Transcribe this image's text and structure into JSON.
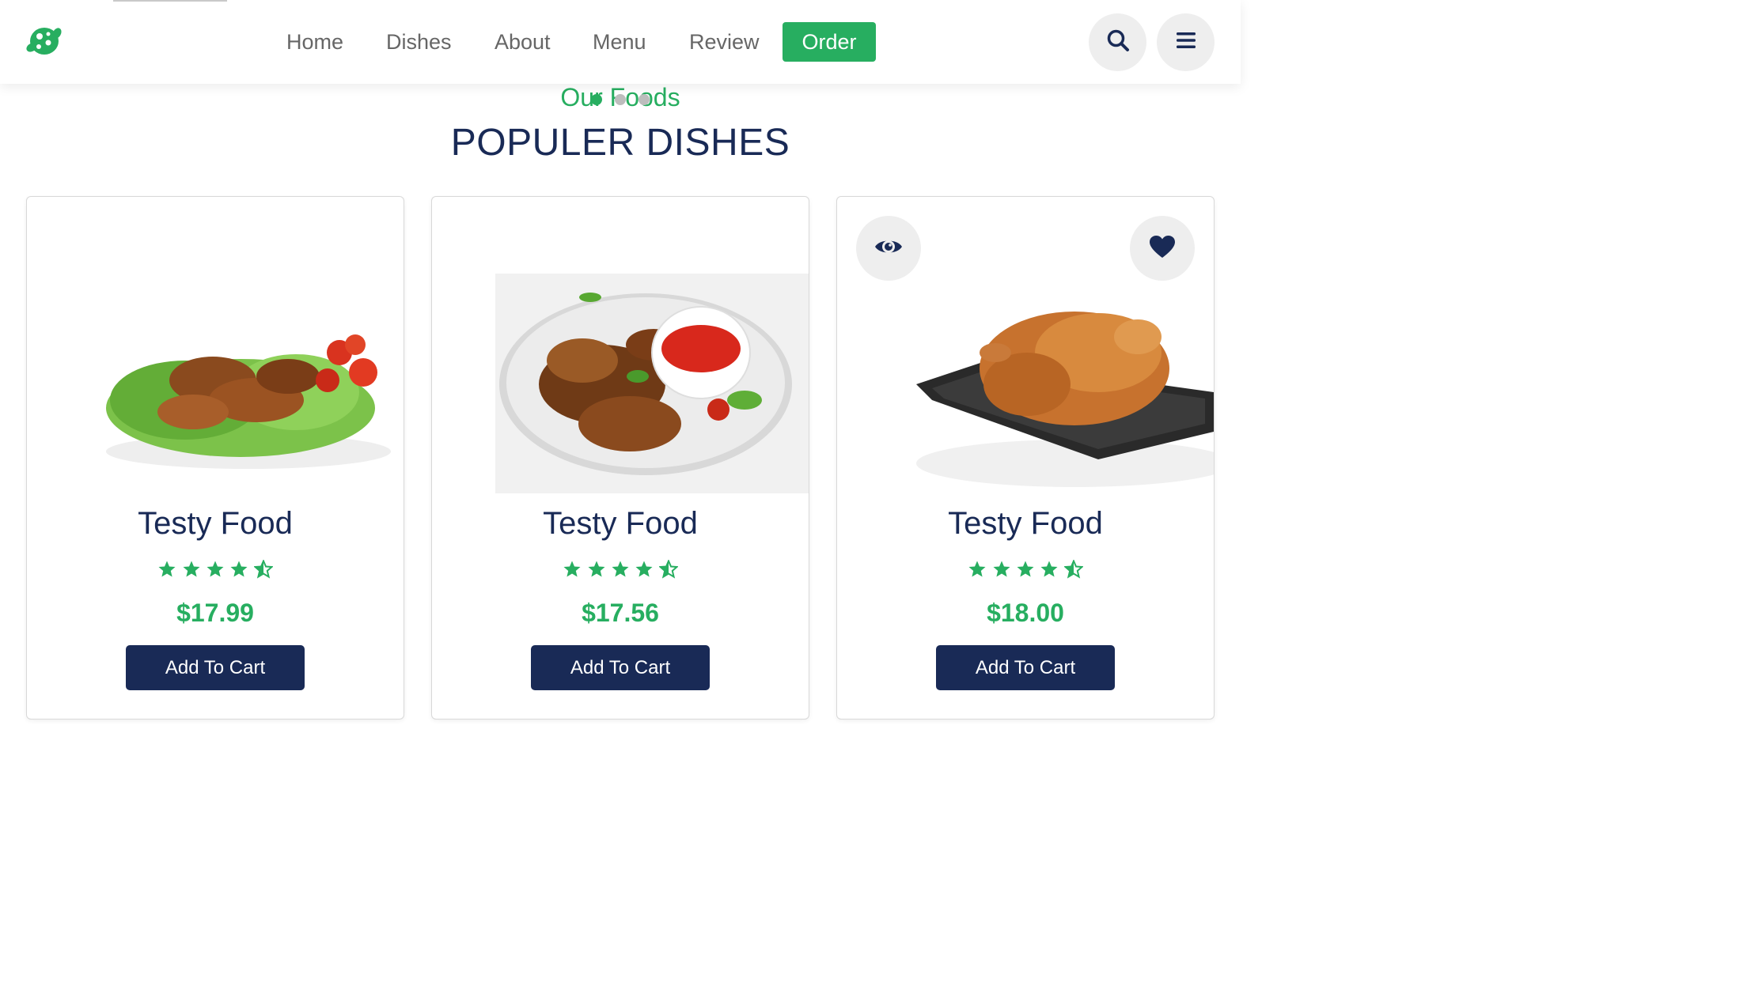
{
  "header": {
    "logo_icon": "food-logo-icon",
    "nav": [
      "Home",
      "Dishes",
      "About",
      "Menu",
      "Review"
    ],
    "order_label": "Order",
    "search_icon": "search-icon",
    "menu_icon": "hamburger-menu-icon"
  },
  "section": {
    "subheading": "Our Foods",
    "heading": "POPULER DISHES"
  },
  "colors": {
    "accent": "#27ae60",
    "primary": "#192a56",
    "muted": "#666666"
  },
  "cards": [
    {
      "title": "Testy Food",
      "rating": 4.5,
      "price": "$17.99",
      "button": "Add To Cart",
      "image": "chicken-wings-with-lettuce-and-tomatoes"
    },
    {
      "title": "Testy Food",
      "rating": 4.5,
      "price": "$17.56",
      "button": "Add To Cart",
      "image": "chicken-wings-with-dip-sauce"
    },
    {
      "title": "Testy Food",
      "rating": 4.5,
      "price": "$18.00",
      "button": "Add To Cart",
      "image": "roast-chicken-on-tray",
      "actions": [
        "eye-icon",
        "heart-icon"
      ]
    }
  ]
}
